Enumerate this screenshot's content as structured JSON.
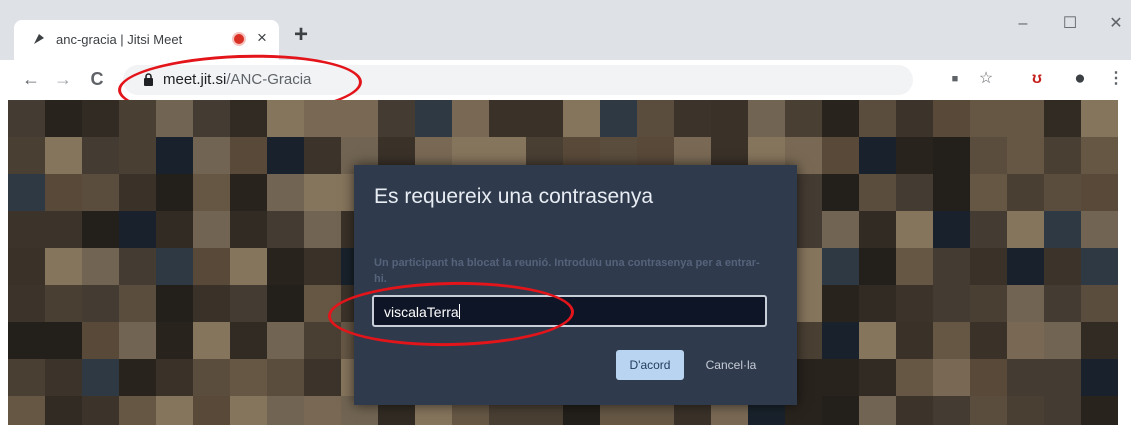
{
  "tab": {
    "title": "anc-gracia | Jitsi Meet",
    "close_glyph": "×",
    "favicon": "jitsi-logo-icon",
    "indicator": "recording-dot-icon"
  },
  "new_tab": {
    "glyph": "+"
  },
  "window_controls": {
    "minimize": "–",
    "maximize": "☐",
    "close": "✕"
  },
  "nav": {
    "back": "←",
    "forward": "→",
    "reload": "C"
  },
  "address_bar": {
    "host": "meet.jit.si",
    "path": "/ANC-Gracia"
  },
  "toolbar_icons": {
    "camera": "■",
    "star": "☆",
    "extension": "ʊ",
    "profile": "●",
    "menu": "⋮"
  },
  "dialog": {
    "title": "Es requereix una contrasenya",
    "description": "Un participant ha blocat la reunió. Introduïu una contrasenya per a entrar-hi.",
    "password_value": "viscalaTerra",
    "ok_label": "D'acord",
    "cancel_label": "Cancel·la"
  },
  "colors": {
    "annotation": "#e3141a",
    "dialog_bg": "#2f3b4d",
    "ok_button": "#b8d4f0"
  }
}
